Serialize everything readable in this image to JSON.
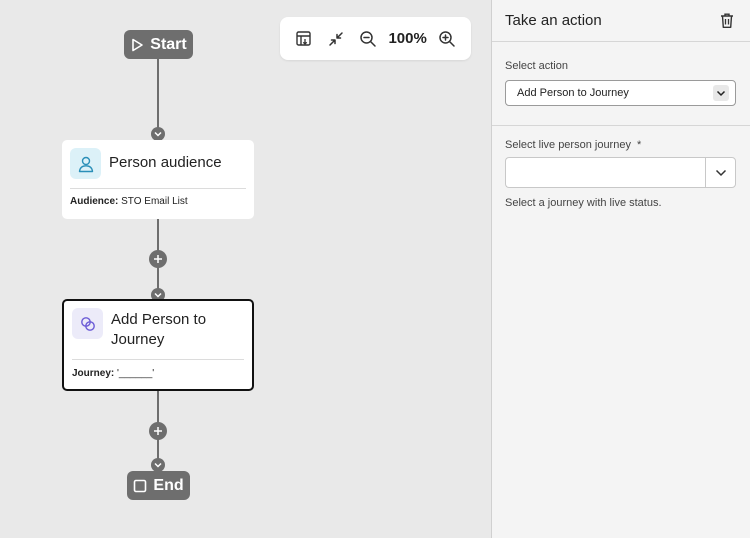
{
  "canvas": {
    "start_label": "Start",
    "end_label": "End",
    "nodes": [
      {
        "title": "Person audience",
        "meta_key": "Audience:",
        "meta_value": "STO Email List",
        "icon": "person-icon"
      },
      {
        "title": "Add Person to Journey",
        "meta_key": "Journey:",
        "meta_value": "'______'",
        "icon": "journey-link-icon"
      }
    ]
  },
  "toolbar": {
    "zoom_label": "100%",
    "icons": [
      "fit-to-screen-icon",
      "collapse-icon",
      "zoom-out-icon",
      "zoom-in-icon"
    ]
  },
  "panel": {
    "title": "Take an action",
    "select_action_label": "Select action",
    "select_action_value": "Add Person to Journey",
    "journey_label": "Select live person journey",
    "required_mark": "*",
    "journey_value": "",
    "journey_help": "Select a journey with live status."
  },
  "colors": {
    "connector": "#6e6e6e",
    "audience_tile": "#dcf1f8",
    "journey_tile": "#ecebf9"
  }
}
